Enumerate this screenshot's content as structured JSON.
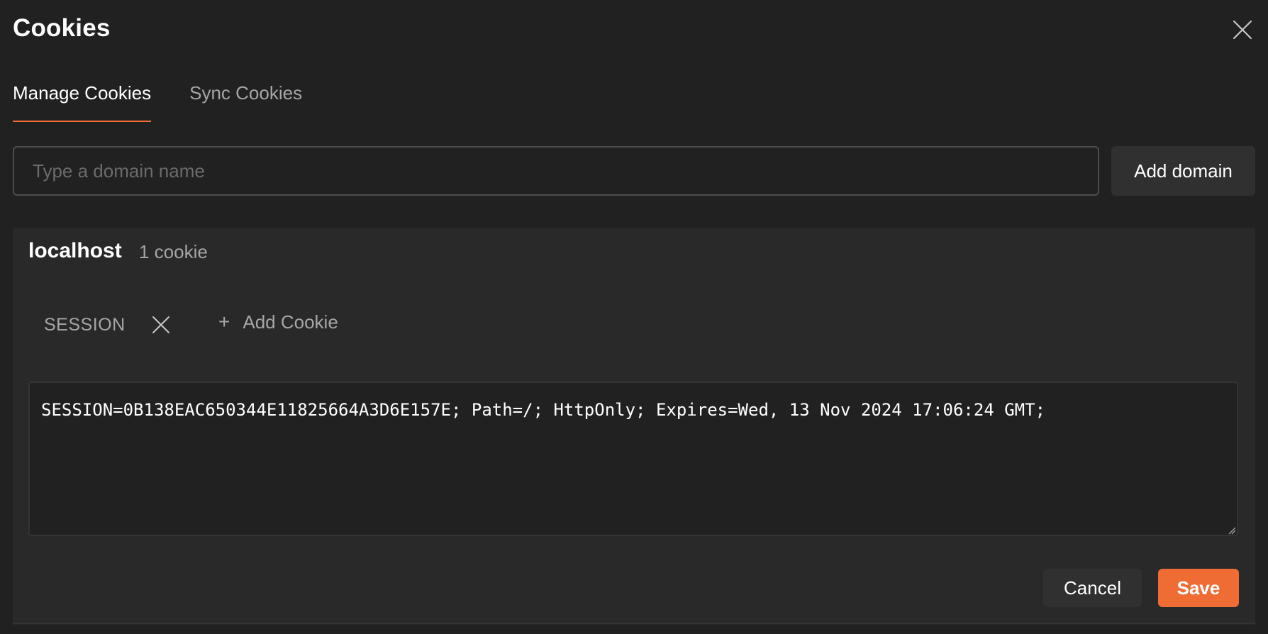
{
  "dialog": {
    "title": "Cookies"
  },
  "tabs": [
    {
      "label": "Manage Cookies",
      "active": true
    },
    {
      "label": "Sync Cookies",
      "active": false
    }
  ],
  "domain_input": {
    "placeholder": "Type a domain name",
    "value": ""
  },
  "add_domain_label": "Add domain",
  "domain": {
    "name": "localhost",
    "count": "1 cookie"
  },
  "cookies": [
    {
      "name": "SESSION"
    }
  ],
  "add_cookie_label": "Add Cookie",
  "cookie_value": "SESSION=0B138EAC650344E11825664A3D6E157E; Path=/; HttpOnly; Expires=Wed, 13 Nov 2024 17:06:24 GMT;",
  "actions": {
    "cancel_label": "Cancel",
    "save_label": "Save"
  },
  "colors": {
    "accent": "#ef6c35",
    "background": "#212121",
    "panel": "#292929"
  },
  "icons": {
    "close": "close-icon",
    "remove_cookie": "x-icon",
    "add": "plus-icon"
  }
}
